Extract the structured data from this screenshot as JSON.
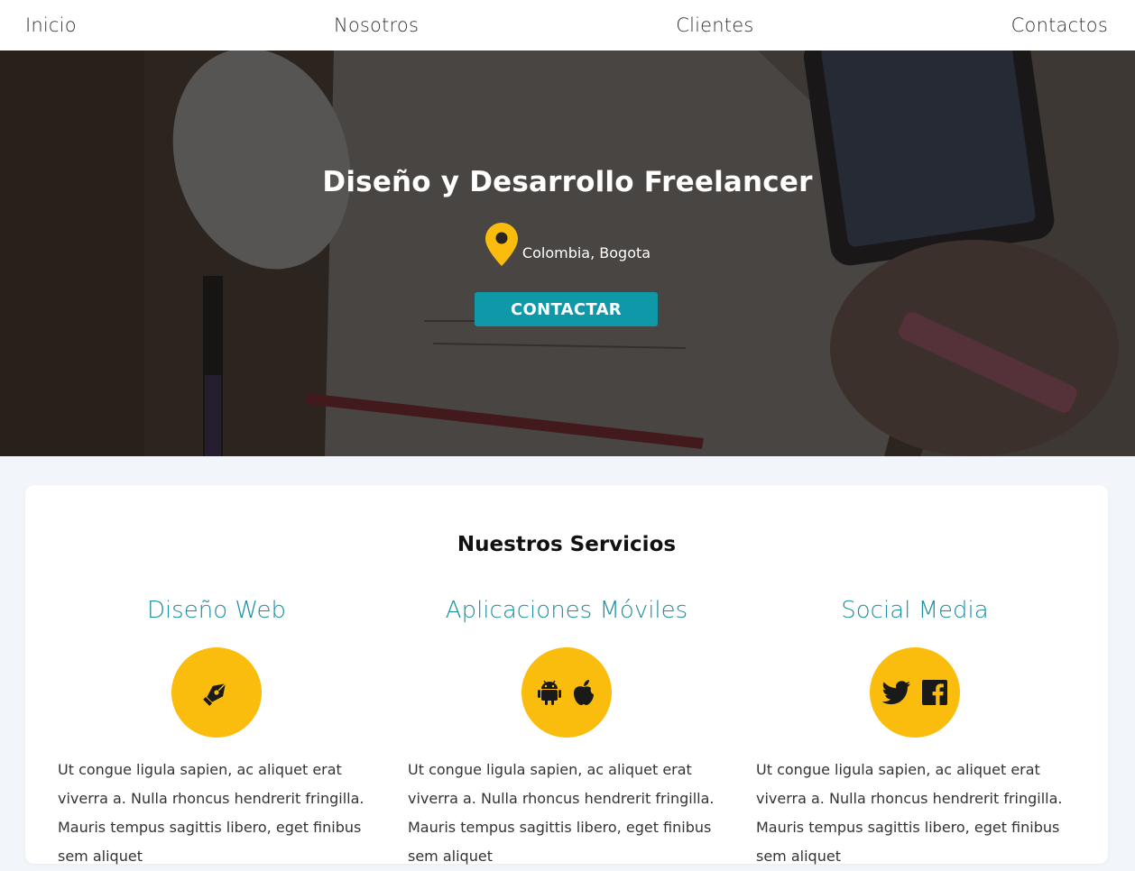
{
  "nav": {
    "items": [
      {
        "label": "Inicio"
      },
      {
        "label": "Nosotros"
      },
      {
        "label": "Clientes"
      },
      {
        "label": "Contactos"
      }
    ]
  },
  "hero": {
    "title": "Diseño y Desarrollo Freelancer",
    "location_icon": "map-marker-icon",
    "location": "Colombia, Bogota",
    "cta_label": "CONTACTAR"
  },
  "services": {
    "title": "Nuestros Servicios",
    "items": [
      {
        "name": "Diseño Web",
        "icons": [
          "pen-nib-icon"
        ],
        "description": "Ut congue ligula sapien, ac aliquet erat viverra a. Nulla rhoncus hendrerit fringilla. Mauris tempus sagittis libero, eget finibus sem aliquet"
      },
      {
        "name": "Aplicaciones Móviles",
        "icons": [
          "android-icon",
          "apple-icon"
        ],
        "description": "Ut congue ligula sapien, ac aliquet erat viverra a. Nulla rhoncus hendrerit fringilla. Mauris tempus sagittis libero, eget finibus sem aliquet"
      },
      {
        "name": "Social Media",
        "icons": [
          "twitter-icon",
          "facebook-icon"
        ],
        "description": "Ut congue ligula sapien, ac aliquet erat viverra a. Nulla rhoncus hendrerit fringilla. Mauris tempus sagittis libero, eget finibus sem aliquet"
      }
    ]
  },
  "colors": {
    "accent_teal": "#0e98a8",
    "icon_yellow": "#fbbd0d",
    "service_title": "#1a8fa0",
    "page_bg": "#f2f5fa"
  }
}
